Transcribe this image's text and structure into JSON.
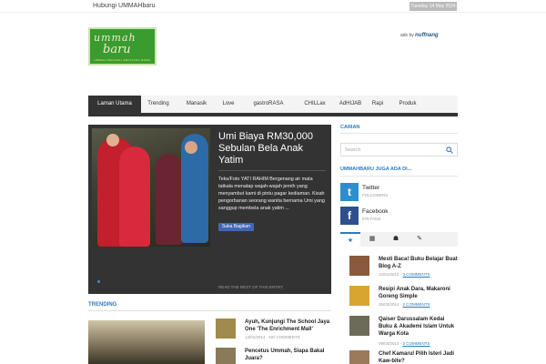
{
  "topbar": {
    "link": "Hubungi UMMAHbaru",
    "date": "Tuesday 14 May 2024"
  },
  "logo": {
    "line1": "ummah",
    "line2": "baru",
    "tagline": "UMMAH BAHARU SENTIASA BARU"
  },
  "ads": {
    "label": "ads by",
    "brand": "nuffnang"
  },
  "nav": [
    "Laman Utama",
    "Trending",
    "Manasik",
    "Love",
    "gastroRASA",
    "CHILLax",
    "AdHIJAB",
    "Rapi",
    "Produk"
  ],
  "slider": {
    "title": "Umi Biaya RM30,000 Sebulan Bela Anak Yatim",
    "text": "Teks/Foto YATI RAHIM Bergenang air mata tatkala menatap wajah-wajah jernih yang menyambut kami di pintu pagar kediaman. Kisah pengorbanan seorang wanita bernama Umi yang sanggup membela anak yatim ...",
    "fb_like": "Suka Bagikan",
    "read_more": "READ THE REST OF THIS ENTRY"
  },
  "trending": {
    "title": "TRENDING",
    "items": [
      {
        "title": "Ayuh, Kunjungi The School Jaya One 'The Enrichment Mall'",
        "meta": "14/01/2014 · NO COMMENTS"
      },
      {
        "title": "Pencetus Ummah, Siapa Bakal Juara?",
        "meta": ""
      }
    ]
  },
  "sidebar": {
    "search_title": "CARIAN",
    "search_placeholder": "Search",
    "social_title": "UMMAHBARU JUGA ADA DI...",
    "social": [
      {
        "name": "Twitter",
        "sub": "FOLLOWERS",
        "glyph": "t",
        "color": "#2b8ed1"
      },
      {
        "name": "Facebook",
        "sub": "578 FANS",
        "glyph": "f",
        "color": "#2d4f8e"
      }
    ],
    "tabs": [
      "★",
      "▦",
      "☗",
      "✎"
    ],
    "posts": [
      {
        "title": "Mesti Baca! Buku Belajar Buat Blog A-Z",
        "date": "12/01/2014",
        "comments": "3 COMMENTS"
      },
      {
        "title": "Resipi Anak Dara, Makaroni Goreng Simple",
        "date": "15/03/2014",
        "comments": "2 COMMENTS"
      },
      {
        "title": "Qaiser Darussalam Kedai Buku & Akademi Islam Untuk Warga Kota",
        "date": "09/03/2014",
        "comments": "2 COMMENTS"
      },
      {
        "title": "Chef Kamarul Pilih Isteri Jadi Kaw-bite?",
        "date": "04/10/2013",
        "comments": "2 COMMENTS"
      }
    ]
  }
}
